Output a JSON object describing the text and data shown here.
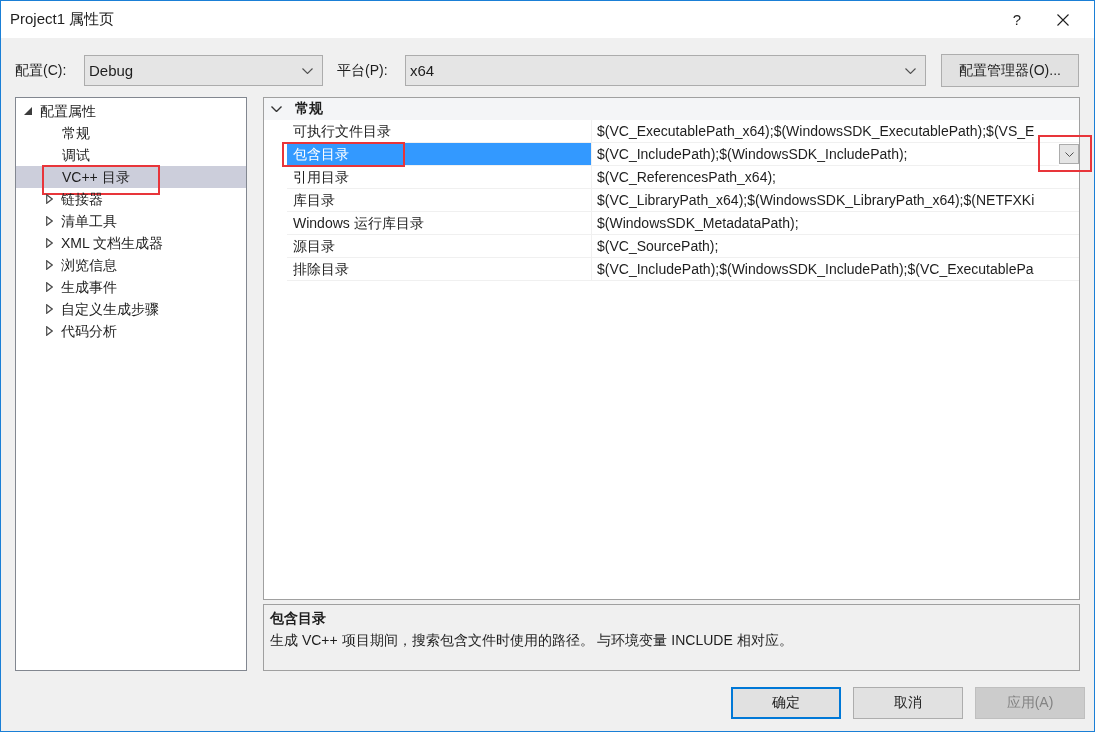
{
  "window": {
    "title": "Project1 属性页",
    "help": "?"
  },
  "config_bar": {
    "configuration": {
      "label": "配置(C):",
      "value": "Debug"
    },
    "platform": {
      "label": "平台(P):",
      "value": "x64"
    },
    "manager_button": "配置管理器(O)..."
  },
  "tree": {
    "items": [
      {
        "label": "配置属性",
        "kind": "folder",
        "expanded": true,
        "selected": false,
        "highlighted": false,
        "children": [
          {
            "label": "常规",
            "kind": "page",
            "selected": false,
            "highlighted": false
          },
          {
            "label": "调试",
            "kind": "page",
            "selected": false,
            "highlighted": false
          },
          {
            "label": "VC++ 目录",
            "kind": "page",
            "selected": true,
            "highlighted": true
          },
          {
            "label": "链接器",
            "kind": "folder",
            "expanded": false,
            "selected": false,
            "highlighted": false
          },
          {
            "label": "清单工具",
            "kind": "folder",
            "expanded": false,
            "selected": false,
            "highlighted": false
          },
          {
            "label": "XML 文档生成器",
            "kind": "folder",
            "expanded": false,
            "selected": false,
            "highlighted": false
          },
          {
            "label": "浏览信息",
            "kind": "folder",
            "expanded": false,
            "selected": false,
            "highlighted": false
          },
          {
            "label": "生成事件",
            "kind": "folder",
            "expanded": false,
            "selected": false,
            "highlighted": false
          },
          {
            "label": "自定义生成步骤",
            "kind": "folder",
            "expanded": false,
            "selected": false,
            "highlighted": false
          },
          {
            "label": "代码分析",
            "kind": "folder",
            "expanded": false,
            "selected": false,
            "highlighted": false
          }
        ]
      }
    ]
  },
  "property_grid": {
    "categories": [
      {
        "label": "常规",
        "expanded": true,
        "rows": [
          {
            "name": "可执行文件目录",
            "value": "$(VC_ExecutablePath_x64);$(WindowsSDK_ExecutablePath);$(VS_E",
            "selected": false,
            "highlighted": false,
            "dropdown_highlighted": false
          },
          {
            "name": "包含目录",
            "value": "$(VC_IncludePath);$(WindowsSDK_IncludePath);",
            "selected": true,
            "highlighted": true,
            "dropdown_highlighted": true
          },
          {
            "name": "引用目录",
            "value": "$(VC_ReferencesPath_x64);",
            "selected": false,
            "highlighted": false,
            "dropdown_highlighted": false
          },
          {
            "name": "库目录",
            "value": "$(VC_LibraryPath_x64);$(WindowsSDK_LibraryPath_x64);$(NETFXKi",
            "selected": false,
            "highlighted": false,
            "dropdown_highlighted": false
          },
          {
            "name": "Windows 运行库目录",
            "value": "$(WindowsSDK_MetadataPath);",
            "selected": false,
            "highlighted": false,
            "dropdown_highlighted": false
          },
          {
            "name": "源目录",
            "value": "$(VC_SourcePath);",
            "selected": false,
            "highlighted": false,
            "dropdown_highlighted": false
          },
          {
            "name": "排除目录",
            "value": "$(VC_IncludePath);$(WindowsSDK_IncludePath);$(VC_ExecutablePa",
            "selected": false,
            "highlighted": false,
            "dropdown_highlighted": false
          }
        ]
      }
    ]
  },
  "description": {
    "title": "包含目录",
    "text": "生成 VC++ 项目期间，搜索包含文件时使用的路径。 与环境变量 INCLUDE 相对应。"
  },
  "buttons": [
    {
      "label": "确定",
      "default": true,
      "disabled": false
    },
    {
      "label": "取消",
      "default": false,
      "disabled": false
    },
    {
      "label": "应用(A)",
      "default": false,
      "disabled": true
    }
  ]
}
